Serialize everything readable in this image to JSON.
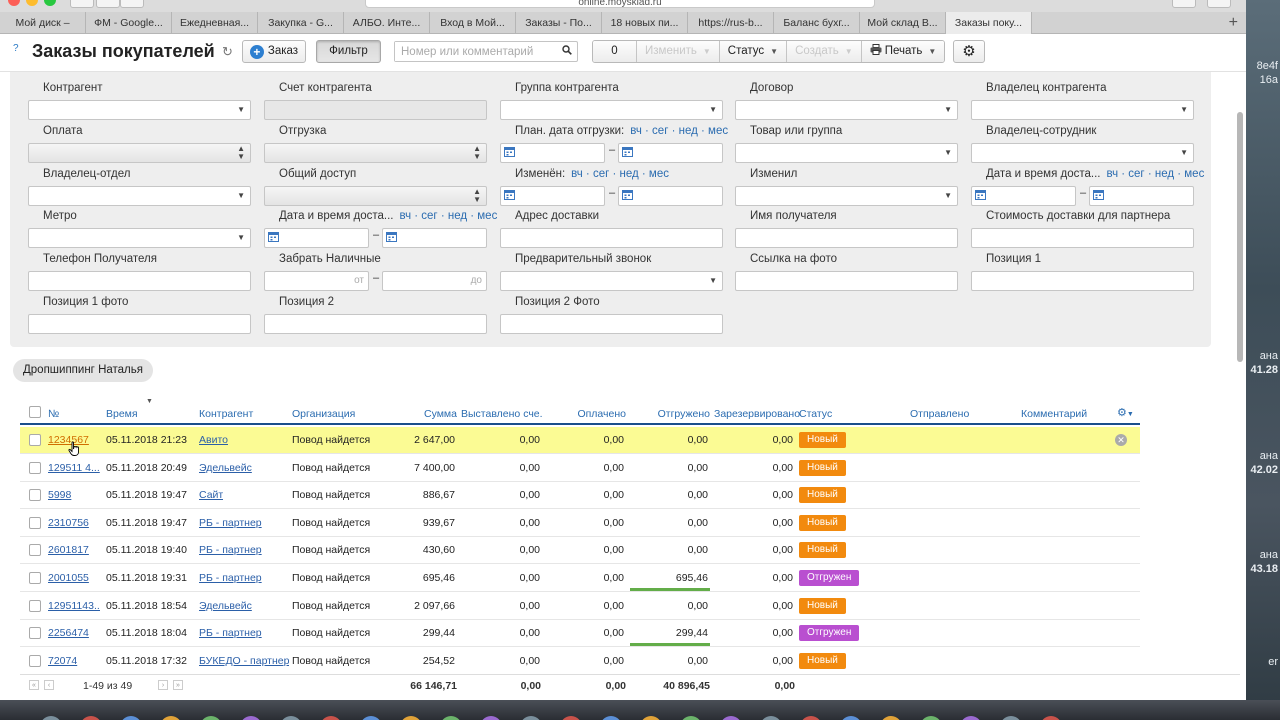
{
  "browser": {
    "url": "online.moysklad.ru",
    "tabs": [
      {
        "label": "Мой диск –"
      },
      {
        "label": "ФМ - Google..."
      },
      {
        "label": "Ежедневная..."
      },
      {
        "label": "Закупка - G..."
      },
      {
        "label": "АЛБО. Инте..."
      },
      {
        "label": "Вход в Мой..."
      },
      {
        "label": "Заказы - По..."
      },
      {
        "label": "18 новых пи..."
      },
      {
        "label": "https://rus-b..."
      },
      {
        "label": "Баланс бухг..."
      },
      {
        "label": "Мой склад В..."
      },
      {
        "label": "Заказы поку..."
      }
    ],
    "add_tab": "+"
  },
  "toolbar": {
    "help": "?",
    "title": "Заказы покупателей",
    "refresh_icon": "↻",
    "order_label": "Заказ",
    "filter_label": "Фильтр",
    "search_placeholder": "Номер или комментарий",
    "count": "0",
    "change_label": "Изменить",
    "status_label": "Статус",
    "create_label": "Создать",
    "print_label": "Печать",
    "settings_icon": "⚙"
  },
  "filters": {
    "contragent": "Контрагент",
    "contragent_account": "Счет контрагента",
    "contragent_group": "Группа контрагента",
    "contract": "Договор",
    "contragent_owner": "Владелец контрагента",
    "payment": "Оплата",
    "shipment": "Отгрузка",
    "planned_ship_date": "План. дата отгрузки:",
    "product_or_group": "Товар или группа",
    "owner_employee": "Владелец-сотрудник",
    "owner_department": "Владелец-отдел",
    "shared_access": "Общий доступ",
    "changed": "Изменён:",
    "changed_by": "Изменил",
    "delivery_datetime": "Дата и время доста...",
    "metro": "Метро",
    "delivery_datetime2": "Дата и время доста...",
    "delivery_address": "Адрес доставки",
    "recipient_name": "Имя получателя",
    "partner_delivery_cost": "Стоимость доставки для партнера",
    "recipient_phone": "Телефон Получателя",
    "pick_cash": "Забрать Наличные",
    "range_from": "от",
    "range_to": "до",
    "prelim_call": "Предварительный звонок",
    "photo_link": "Ссылка на фото",
    "position1": "Позиция 1",
    "position1_photo": "Позиция 1 фото",
    "position2": "Позиция 2",
    "position2_photo": "Позиция 2 Фото",
    "quick_dates": "вч · сег · нед · мес",
    "dash": "–"
  },
  "saved_filter": "Дропшиппинг Наталья",
  "table": {
    "columns": {
      "num": "№",
      "time": "Время",
      "contragent": "Контрагент",
      "org": "Организация",
      "sum": "Сумма",
      "invoiced": "Выставлено сче...",
      "paid": "Оплачено",
      "shipped": "Отгружено",
      "reserved": "Зарезервировано",
      "status": "Статус",
      "sent": "Отправлено",
      "comment": "Комментарий"
    },
    "rows": [
      {
        "num": "1234567",
        "time": "05.11.2018 21:23",
        "contragent": "Авито",
        "org": "Повод найдется",
        "sum": "2 647,00",
        "invoiced": "0,00",
        "paid": "0,00",
        "shipped": "0,00",
        "reserved": "0,00",
        "status": "Новый",
        "status_color": "#f28a0e"
      },
      {
        "num": "129511 4...",
        "time": "05.11.2018 20:49",
        "contragent": "Эдельвейс",
        "org": "Повод найдется",
        "sum": "7 400,00",
        "invoiced": "0,00",
        "paid": "0,00",
        "shipped": "0,00",
        "reserved": "0,00",
        "status": "Новый",
        "status_color": "#f28a0e"
      },
      {
        "num": "5998",
        "time": "05.11.2018 19:47",
        "contragent": "Сайт",
        "org": "Повод найдется",
        "sum": "886,67",
        "invoiced": "0,00",
        "paid": "0,00",
        "shipped": "0,00",
        "reserved": "0,00",
        "status": "Новый",
        "status_color": "#f28a0e"
      },
      {
        "num": "2310756",
        "time": "05.11.2018 19:47",
        "contragent": "РБ - партнер",
        "org": "Повод найдется",
        "sum": "939,67",
        "invoiced": "0,00",
        "paid": "0,00",
        "shipped": "0,00",
        "reserved": "0,00",
        "status": "Новый",
        "status_color": "#f28a0e"
      },
      {
        "num": "2601817",
        "time": "05.11.2018 19:40",
        "contragent": "РБ - партнер",
        "org": "Повод найдется",
        "sum": "430,60",
        "invoiced": "0,00",
        "paid": "0,00",
        "shipped": "0,00",
        "reserved": "0,00",
        "status": "Новый",
        "status_color": "#f28a0e"
      },
      {
        "num": "2001055",
        "time": "05.11.2018 19:31",
        "contragent": "РБ - партнер",
        "org": "Повод найдется",
        "sum": "695,46",
        "invoiced": "0,00",
        "paid": "0,00",
        "shipped": "695,46",
        "reserved": "0,00",
        "status": "Отгружен",
        "status_color": "#b94fd0"
      },
      {
        "num": "12951143...",
        "time": "05.11.2018 18:54",
        "contragent": "Эдельвейс",
        "org": "Повод найдется",
        "sum": "2 097,66",
        "invoiced": "0,00",
        "paid": "0,00",
        "shipped": "0,00",
        "reserved": "0,00",
        "status": "Новый",
        "status_color": "#f28a0e"
      },
      {
        "num": "2256474",
        "time": "05.11.2018 18:04",
        "contragent": "РБ - партнер",
        "org": "Повод найдется",
        "sum": "299,44",
        "invoiced": "0,00",
        "paid": "0,00",
        "shipped": "299,44",
        "reserved": "0,00",
        "status": "Отгружен",
        "status_color": "#b94fd0"
      },
      {
        "num": "72074",
        "time": "05.11.2018 17:32",
        "contragent": "БУКЕДО - партнер",
        "org": "Повод найдется",
        "sum": "254,52",
        "invoiced": "0,00",
        "paid": "0,00",
        "shipped": "0,00",
        "reserved": "0,00",
        "status": "Новый",
        "status_color": "#f28a0e"
      }
    ],
    "totals": {
      "range": "1-49 из 49",
      "sum": "66 146,71",
      "invoiced": "0,00",
      "paid": "0,00",
      "shipped": "40 896,45",
      "reserved": "0,00"
    }
  },
  "desktop": {
    "texts": [
      "8e4f",
      "16a",
      "ана",
      "41.28",
      "ана",
      "42.02",
      "ана",
      "43.18",
      "er"
    ]
  },
  "colors": {
    "accent": "#2b6cb0",
    "highlight_row": "#fbfb94",
    "status_new": "#f28a0e",
    "status_shipped": "#b94fd0",
    "ship_progress": "#63ad49"
  }
}
